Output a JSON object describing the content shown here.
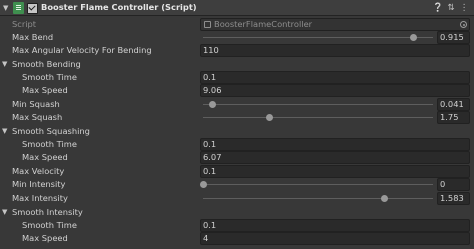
{
  "header": {
    "title": "Booster Flame Controller (Script)",
    "fold_icon": "triangle-down",
    "script_icon": "csharp-script",
    "enabled": true,
    "help_icon": "question-circle",
    "preset_icon": "sliders",
    "menu_icon": "vertical-ellipsis"
  },
  "script_row": {
    "label": "Script",
    "value": "BoosterFlameController",
    "picker_icon": "object-picker-circle"
  },
  "fields": {
    "max_bend": {
      "label": "Max Bend",
      "value": "0.915",
      "slider_fraction": 0.915
    },
    "max_angular_velocity": {
      "label": "Max Angular Velocity For Bending",
      "value": "110"
    },
    "smooth_bending": {
      "label": "Smooth Bending",
      "smooth_time": {
        "label": "Smooth Time",
        "value": "0.1"
      },
      "max_speed": {
        "label": "Max Speed",
        "value": "9.06"
      }
    },
    "min_squash": {
      "label": "Min Squash",
      "value": "0.041",
      "slider_fraction": 0.041
    },
    "max_squash": {
      "label": "Max Squash",
      "value": "1.75",
      "slider_fraction": 0.29
    },
    "smooth_squashing": {
      "label": "Smooth Squashing",
      "smooth_time": {
        "label": "Smooth Time",
        "value": "0.1"
      },
      "max_speed": {
        "label": "Max Speed",
        "value": "6.07"
      }
    },
    "max_velocity": {
      "label": "Max Velocity",
      "value": "0.1"
    },
    "min_intensity": {
      "label": "Min Intensity",
      "value": "0",
      "slider_fraction": 0.0
    },
    "max_intensity": {
      "label": "Max Intensity",
      "value": "1.583",
      "slider_fraction": 0.79
    },
    "smooth_intensity": {
      "label": "Smooth Intensity",
      "smooth_time": {
        "label": "Smooth Time",
        "value": "0.1"
      },
      "max_speed": {
        "label": "Max Speed",
        "value": "4"
      }
    }
  },
  "colors": {
    "background": "#383838",
    "field": "#2a2a2a",
    "header": "#3e3e3e",
    "script_icon": "#3f8f4f",
    "text": "#d2d2d2"
  }
}
